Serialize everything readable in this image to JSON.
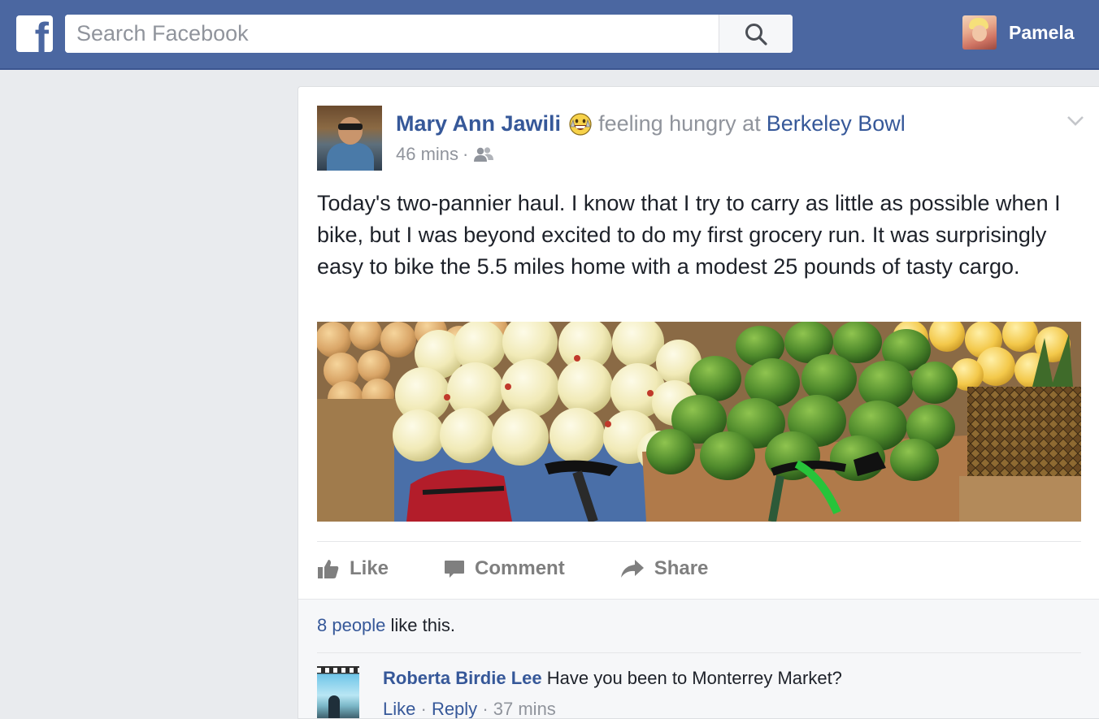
{
  "topbar": {
    "logo_letter": "f",
    "search_placeholder": "Search Facebook",
    "search_value": "",
    "profile_name": "Pamela"
  },
  "post": {
    "author": "Mary Ann Jawili",
    "feeling_emoji": "hungry-face-icon",
    "feeling_text": "feeling hungry at",
    "place": "Berkeley Bowl",
    "timestamp": "46 mins",
    "separator": "·",
    "audience_icon": "friends-icon",
    "text": "Today's two-pannier haul. I know that I try to carry as little as possible when I bike, but I was beyond excited to do my first grocery run. It was surprisingly easy to bike the 5.5 miles home with a modest 25 pounds of tasty cargo.",
    "actions": {
      "like": "Like",
      "comment": "Comment",
      "share": "Share"
    }
  },
  "likes": {
    "count_link": "8 people",
    "suffix": " like this."
  },
  "comment": {
    "author": "Roberta Birdie Lee",
    "text": "Have you been to Monterrey Market?",
    "like": "Like",
    "reply": "Reply",
    "separator": "·",
    "time": "37 mins"
  },
  "colors": {
    "brand_blue": "#4b67a1",
    "link_blue": "#365899",
    "meta_gray": "#90949c",
    "background": "#e9ebee"
  }
}
